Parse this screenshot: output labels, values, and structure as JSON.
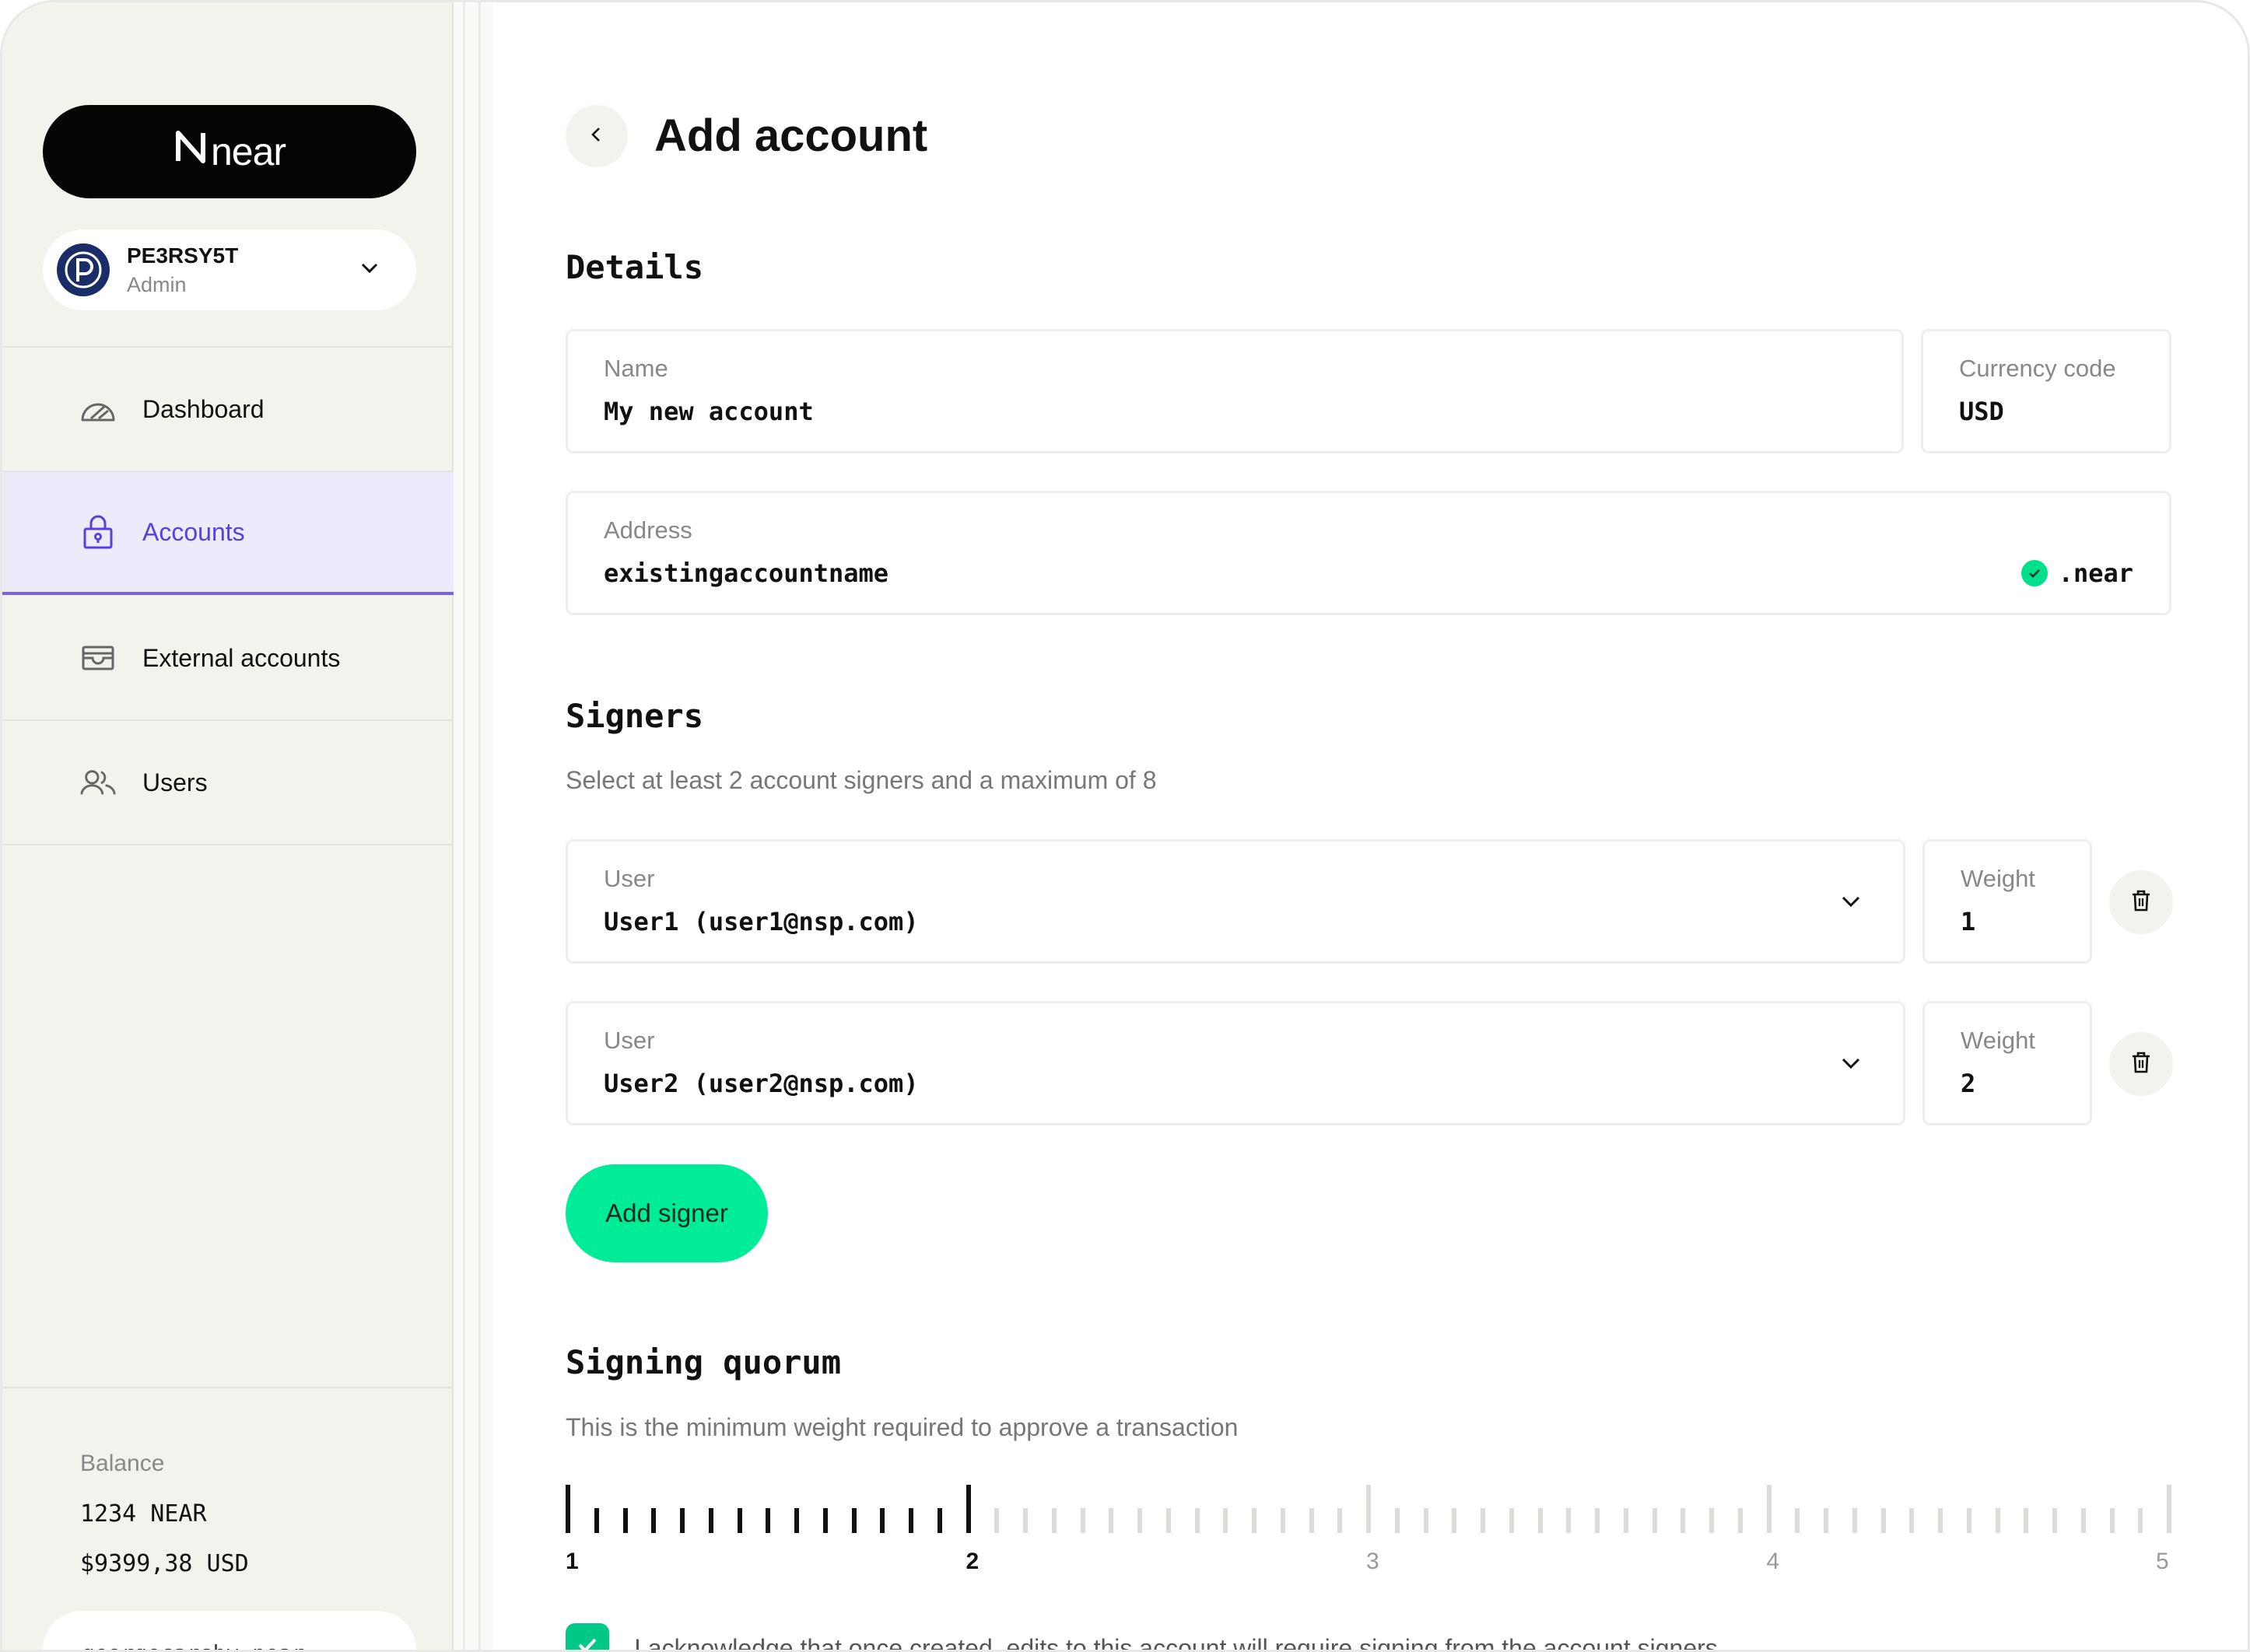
{
  "sidebar": {
    "logo_text": "near",
    "org": {
      "name": "PE3RSY5T",
      "role": "Admin"
    },
    "items": [
      {
        "label": "Dashboard",
        "icon": "gauge-icon"
      },
      {
        "label": "Accounts",
        "icon": "lock-icon",
        "active": true
      },
      {
        "label": "External accounts",
        "icon": "wallet-icon"
      },
      {
        "label": "Users",
        "icon": "users-icon"
      }
    ],
    "balance": {
      "label": "Balance",
      "near": "1234 NEAR",
      "usd": "$9399,38 USD"
    },
    "wallet_name": "georgecarsby.near"
  },
  "main": {
    "title": "Add account",
    "details": {
      "heading": "Details",
      "name": {
        "label": "Name",
        "value": "My new account"
      },
      "currency": {
        "label": "Currency code",
        "value": "USD"
      },
      "address": {
        "label": "Address",
        "value": "existingaccountname",
        "suffix": ".near"
      }
    },
    "signers": {
      "heading": "Signers",
      "subtitle": "Select at least 2 account signers and a maximum of 8",
      "rows": [
        {
          "user_label": "User",
          "user_value": "User1 (user1@nsp.com)",
          "weight_label": "Weight",
          "weight_value": "1"
        },
        {
          "user_label": "User",
          "user_value": "User2 (user2@nsp.com)",
          "weight_label": "Weight",
          "weight_value": "2"
        }
      ],
      "add_button": "Add signer"
    },
    "quorum": {
      "heading": "Signing quorum",
      "subtitle": "This is the minimum weight required to approve a transaction",
      "min": 1,
      "max": 5,
      "value": 2,
      "labels": [
        "1",
        "2",
        "3",
        "4",
        "5"
      ]
    },
    "acknowledge": {
      "checked": true,
      "text": "I acknowledge that once created, edits to this account will require signing from the account signers."
    }
  },
  "colors": {
    "accent_green": "#00ec97",
    "active_nav": "#5a3fd8",
    "active_nav_bg": "#ecebfb"
  }
}
